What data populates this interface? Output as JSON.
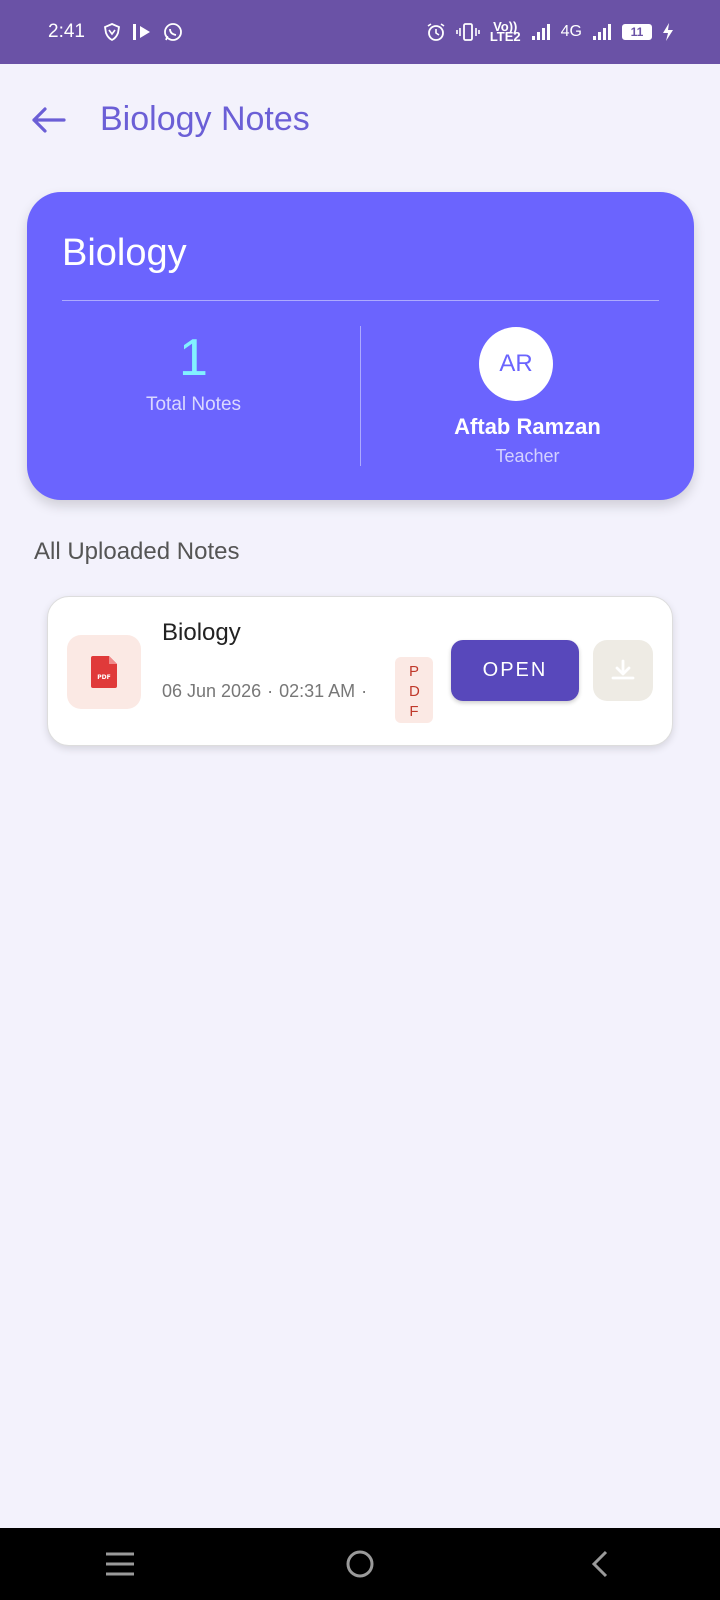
{
  "status_bar": {
    "time": "2:41",
    "network": "4G",
    "volte": "Vo))",
    "lte": "LTE2",
    "battery": "11"
  },
  "header": {
    "title": "Biology Notes"
  },
  "subject_card": {
    "subject": "Biology",
    "notes_count": "1",
    "notes_label": "Total Notes",
    "teacher_initials": "AR",
    "teacher_name": "Aftab Ramzan",
    "teacher_role": "Teacher",
    "accent_color": "#6b64fe",
    "count_color": "#82f1ff"
  },
  "section": {
    "heading": "All Uploaded Notes"
  },
  "notes": [
    {
      "title": "Biology",
      "date": "06 Jun 2026",
      "time": "02:31 AM",
      "type": "PDF",
      "open_label": "OPEN",
      "icon": "pdf-file-icon"
    }
  ],
  "colors": {
    "status_bar": "#6a52a6",
    "background": "#f3f2fc",
    "open_button": "#5848bb"
  }
}
